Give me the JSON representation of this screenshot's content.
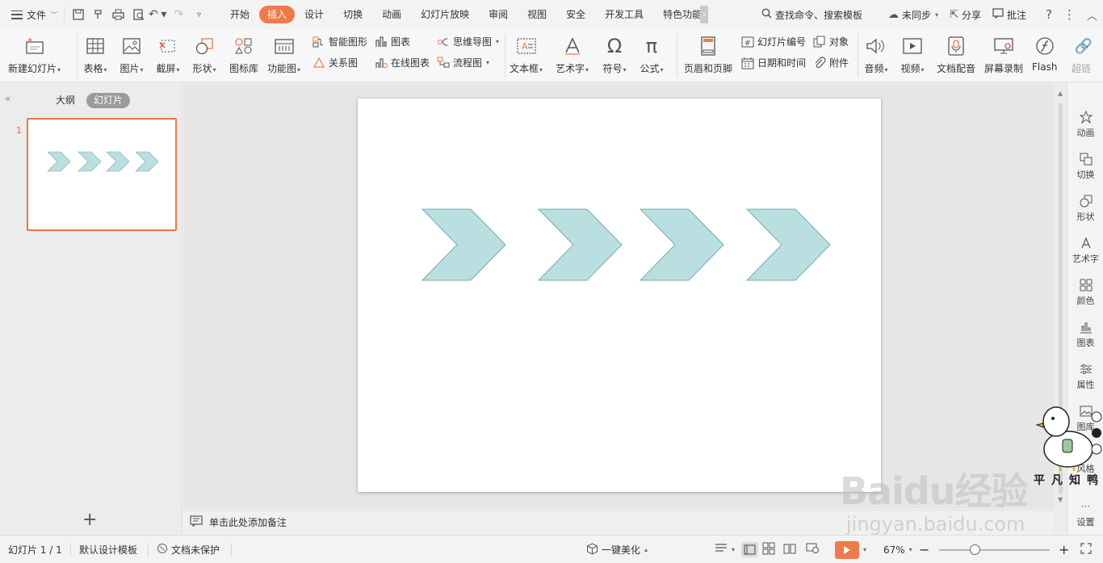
{
  "menubar": {
    "file_label": "文件",
    "tabs": [
      "开始",
      "插入",
      "设计",
      "切换",
      "动画",
      "幻灯片放映",
      "审阅",
      "视图",
      "安全",
      "开发工具",
      "特色功能"
    ],
    "active_tab": "插入",
    "search_placeholder": "查找命令、搜索模板",
    "sync_label": "未同步",
    "share_label": "分享",
    "comment_label": "批注"
  },
  "ribbon": {
    "new_slide": "新建幻灯片",
    "table": "表格",
    "picture": "图片",
    "screenshot": "截屏",
    "shape": "形状",
    "icon_lib": "图标库",
    "function_chart": "功能图",
    "smart_art": "智能图形",
    "chart": "图表",
    "relation": "关系图",
    "online_chart": "在线图表",
    "mindmap": "思维导图",
    "flowchart": "流程图",
    "textbox": "文本框",
    "wordart": "艺术字",
    "symbol": "符号",
    "formula": "公式",
    "header_footer": "页眉和页脚",
    "slide_number": "幻灯片编号",
    "object": "对象",
    "datetime": "日期和时间",
    "attachment": "附件",
    "audio": "音频",
    "video": "视频",
    "doc_voice": "文档配音",
    "screen_record": "屏幕录制",
    "flash": "Flash",
    "hyperlink": "超链"
  },
  "left_panel": {
    "outline_tab": "大纲",
    "slides_tab": "幻灯片",
    "slide_number": "1"
  },
  "notes": {
    "placeholder": "单击此处添加备注"
  },
  "right_pane": {
    "items": [
      "动画",
      "切换",
      "形状",
      "艺术字",
      "颜色",
      "图表",
      "属性",
      "图库",
      "风格",
      "设置"
    ]
  },
  "status": {
    "slide_counter": "幻灯片 1 / 1",
    "template": "默认设计模板",
    "protection": "文档未保护",
    "beautify": "一键美化",
    "zoom": "67%"
  },
  "slide": {
    "shapes": [
      {
        "type": "chevron",
        "fill": "#b9dfe1",
        "stroke": "#7fa9ab"
      },
      {
        "type": "chevron",
        "fill": "#b9dfe1",
        "stroke": "#7fa9ab"
      },
      {
        "type": "chevron",
        "fill": "#b9dfe1",
        "stroke": "#7fa9ab"
      },
      {
        "type": "chevron",
        "fill": "#b9dfe1",
        "stroke": "#7fa9ab"
      }
    ]
  },
  "watermark": {
    "baidu": "Baidu经验",
    "url": "jingyan.baidu.com",
    "mascot_text": "平凡知鸭"
  },
  "colors": {
    "accent": "#f07a4a",
    "chevron_fill": "#b9dfe1",
    "chevron_stroke": "#7fa9ab"
  }
}
